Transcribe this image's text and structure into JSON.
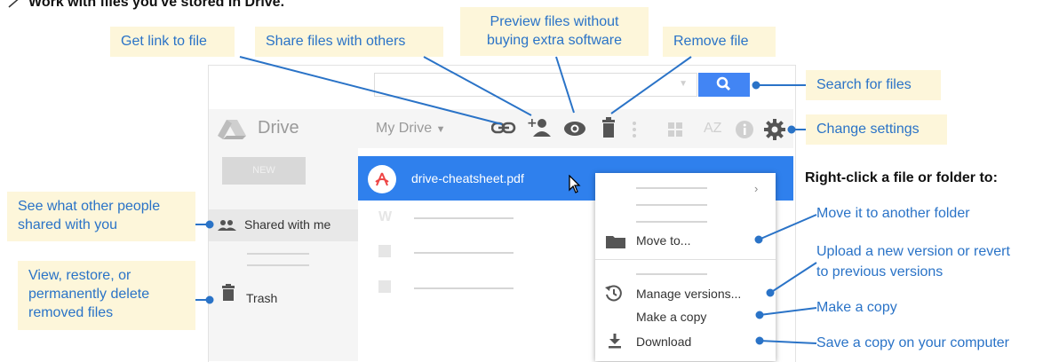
{
  "heading": "Work with files you've stored in Drive.",
  "callouts": {
    "get_link": "Get link to file",
    "share": "Share files with others",
    "preview": [
      "Preview files without",
      "buying extra software"
    ],
    "remove": "Remove file",
    "search": "Search for files",
    "settings": "Change settings",
    "shared": [
      "See what other people",
      "shared with you"
    ],
    "trash": [
      "View, restore, or",
      "permanently delete",
      "removed files"
    ]
  },
  "right_click": {
    "title": "Right-click a file or folder to:",
    "items": [
      "Move it to another folder",
      "Upload a new version or revert",
      "to previous versions",
      "Make a copy",
      "Save a copy on your computer"
    ]
  },
  "drive": {
    "title": "Drive",
    "my_drive": "My Drive",
    "new_label": "NEW",
    "shared_with_me": "Shared with me",
    "trash": "Trash",
    "selected_file": "drive-cheatsheet.pdf",
    "sort_label": "AZ"
  },
  "context_menu": {
    "move_to": "Move to...",
    "manage_versions": "Manage versions...",
    "make_copy": "Make a copy",
    "download": "Download"
  },
  "colors": {
    "accent": "#2f80ed",
    "callout_bg": "#fdf6da",
    "callout_text": "#2a73c7",
    "connector": "#2a73c7"
  }
}
